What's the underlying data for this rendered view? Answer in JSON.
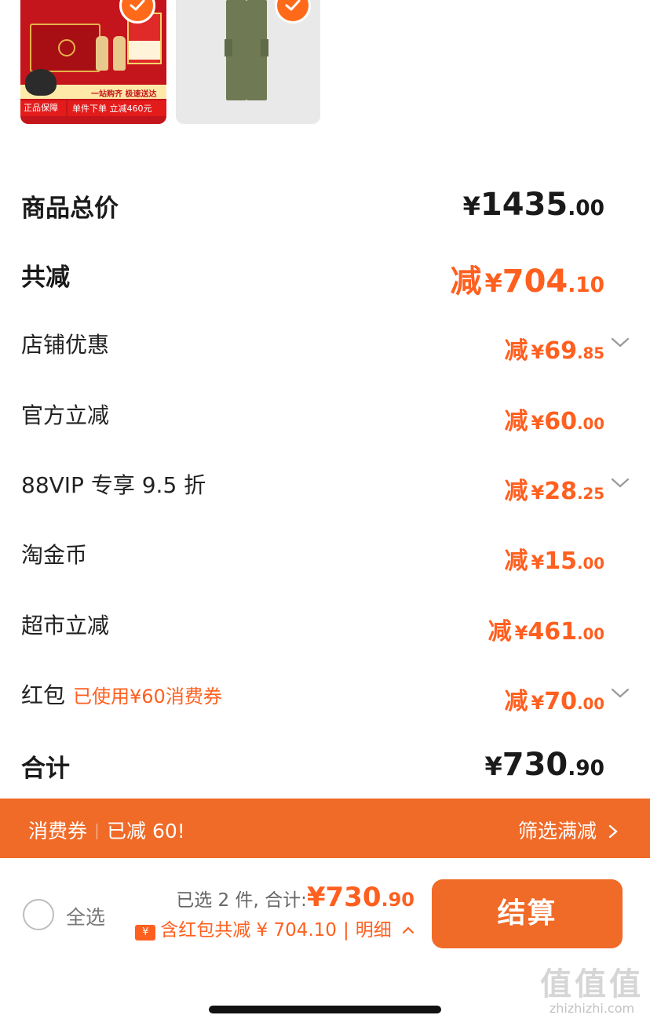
{
  "products": [
    {
      "name": "gift-box-product",
      "selected": true,
      "promo_top": "一站购齐 极速送达",
      "promo_bottom": "单件下单 立减460元",
      "badge": "正品保障"
    },
    {
      "name": "pants-product",
      "selected": true
    }
  ],
  "price_breakdown": {
    "total_goods": {
      "label": "商品总价",
      "value_int": "1435",
      "value_dec": ".00",
      "currency": "¥"
    },
    "total_discount": {
      "label": "共减",
      "prefix": "减",
      "value_int": "704",
      "value_dec": ".10",
      "currency": "¥"
    },
    "items": [
      {
        "label": "店铺优惠",
        "prefix": "减",
        "currency": "¥",
        "value_int": "69",
        "value_dec": ".85",
        "expandable": true
      },
      {
        "label": "官方立减",
        "prefix": "减",
        "currency": "¥",
        "value_int": "60",
        "value_dec": ".00",
        "expandable": false
      },
      {
        "label": "88VIP 专享 9.5 折",
        "prefix": "减",
        "currency": "¥",
        "value_int": "28",
        "value_dec": ".25",
        "expandable": true
      },
      {
        "label": "淘金币",
        "prefix": "减",
        "currency": "¥",
        "value_int": "15",
        "value_dec": ".00",
        "expandable": false
      },
      {
        "label": "超市立减",
        "prefix": "减",
        "currency": "¥",
        "value_int": "461",
        "value_dec": ".00",
        "expandable": false
      },
      {
        "label": "红包",
        "note": "已使用¥60消费券",
        "prefix": "减",
        "currency": "¥",
        "value_int": "70",
        "value_dec": ".00",
        "expandable": true
      }
    ],
    "grand_total": {
      "label": "合计",
      "value_int": "730",
      "value_dec": ".90",
      "currency": "¥"
    }
  },
  "voucher_bar": {
    "left_a": "消费券",
    "left_b": "已减 60!",
    "right": "筛选满减",
    "right_arrow": "chevron-right-icon"
  },
  "footer": {
    "select_all": "全选",
    "selected_count": "已选 2 件, 合计:",
    "total_currency": "¥",
    "total_int": "730",
    "total_dec": ".90",
    "discount_note": "含红包共减 ¥ 704.10",
    "detail_label": "明细",
    "checkout_label": "结算"
  },
  "watermark": {
    "logo": "值值值",
    "text": "zhizhizhi.com"
  },
  "colors": {
    "accent": "#f06a28",
    "price_orange": "#ff5f1f",
    "text": "#1a1a1a"
  }
}
